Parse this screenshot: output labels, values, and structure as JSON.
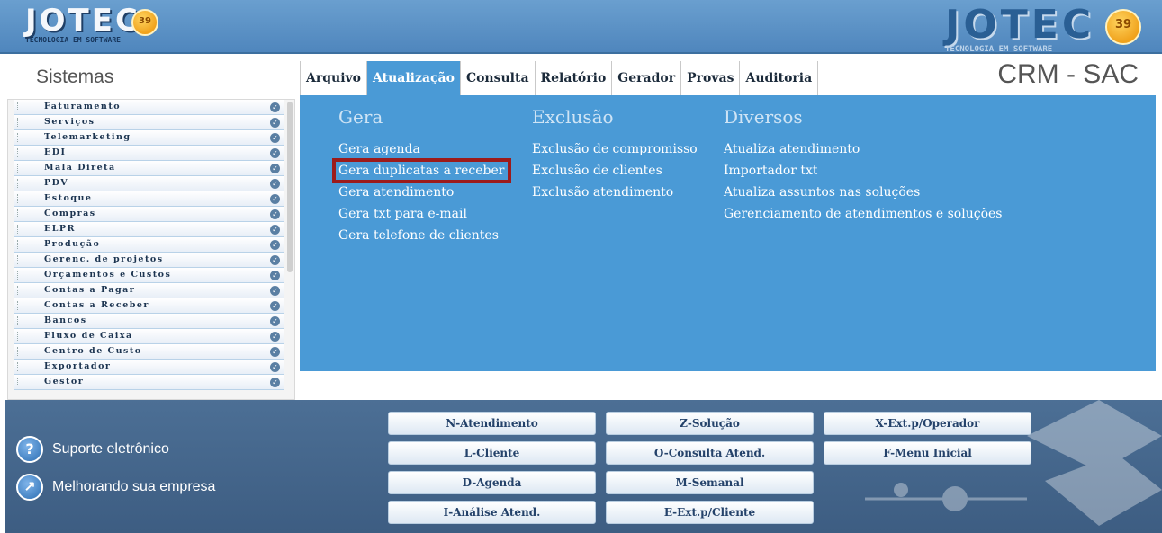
{
  "header": {
    "logo_left": {
      "text": "JOTEC",
      "sub": "TECNOLOGIA EM SOFTWARE",
      "badge": "39"
    },
    "logo_right": {
      "text": "JOTEC",
      "sub": "TECNOLOGIA EM SOFTWARE",
      "badge": "39"
    }
  },
  "title": "Sistemas",
  "app_title": "CRM - SAC",
  "menu": {
    "items": [
      {
        "label": "Arquivo",
        "active": false
      },
      {
        "label": "Atualização",
        "active": true
      },
      {
        "label": "Consulta",
        "active": false
      },
      {
        "label": "Relatório",
        "active": false
      },
      {
        "label": "Gerador",
        "active": false
      },
      {
        "label": "Provas",
        "active": false
      },
      {
        "label": "Auditoria",
        "active": false
      }
    ]
  },
  "sidebar": {
    "items": [
      "Faturamento",
      "Serviços",
      "Telemarketing",
      "EDI",
      "Mala Direta",
      "PDV",
      "Estoque",
      "Compras",
      "ELPR",
      "Produção",
      "Gerenc. de projetos",
      "Orçamentos e Custos",
      "Contas a Pagar",
      "Contas a Receber",
      "Bancos",
      "Fluxo de Caixa",
      "Centro de Custo",
      "Exportador",
      "Gestor"
    ]
  },
  "panel": {
    "gera": {
      "title": "Gera",
      "links": [
        "Gera agenda",
        "Gera duplicatas a receber",
        "Gera atendimento",
        "Gera txt para e-mail",
        "Gera telefone de clientes"
      ]
    },
    "exclusao": {
      "title": "Exclusão",
      "links": [
        "Exclusão de compromisso",
        "Exclusão de clientes",
        "Exclusão atendimento"
      ]
    },
    "diversos": {
      "title": "Diversos",
      "links": [
        "Atualiza atendimento",
        "Importador txt",
        "Atualiza assuntos nas soluções",
        "Gerenciamento de atendimentos e soluções"
      ]
    },
    "highlighted": "Gera duplicatas a receber"
  },
  "footer": {
    "support": "Suporte eletrônico",
    "improve": "Melhorando sua empresa",
    "buttons": {
      "n_atendimento": "N-Atendimento",
      "z_solucao": "Z-Solução",
      "x_ext_operador": "X-Ext.p/Operador",
      "l_cliente": "L-Cliente",
      "o_consulta": "O-Consulta Atend.",
      "f_menu": "F-Menu Inicial",
      "d_agenda": "D-Agenda",
      "m_semanal": "M-Semanal",
      "i_analise": "I-Análise Atend.",
      "e_ext_cliente": "E-Ext.p/Cliente"
    }
  },
  "colors": {
    "panel": "#4a9ad6",
    "footer": "#4c6f95",
    "highlight": "#9c1b1b"
  }
}
